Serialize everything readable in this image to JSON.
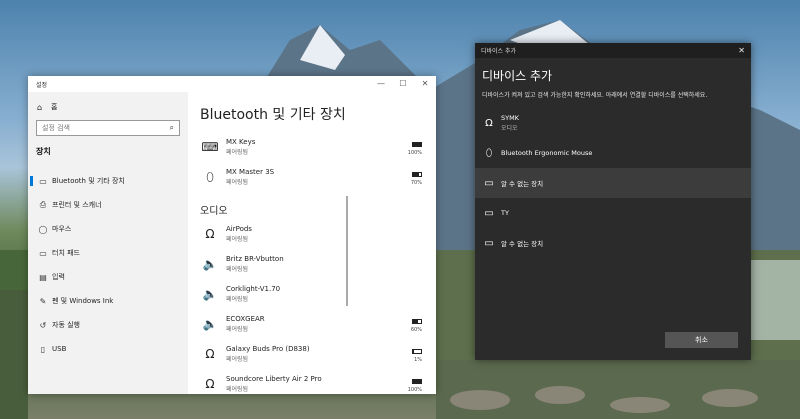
{
  "settings": {
    "window_title": "설정",
    "controls": {
      "minimize": "—",
      "maximize": "☐",
      "close": "✕"
    },
    "home_label": "홈",
    "search_placeholder": "설정 검색",
    "section_label": "장치",
    "nav": [
      {
        "label": "Bluetooth 및 기타 장치",
        "icon": "bluetooth-devices-icon",
        "glyph": "▭"
      },
      {
        "label": "프린터 및 스캐너",
        "icon": "printer-icon",
        "glyph": "⎙"
      },
      {
        "label": "마우스",
        "icon": "mouse-icon",
        "glyph": "◯"
      },
      {
        "label": "터치 패드",
        "icon": "touchpad-icon",
        "glyph": "▭"
      },
      {
        "label": "입력",
        "icon": "keyboard-icon",
        "glyph": "▤"
      },
      {
        "label": "펜 및 Windows Ink",
        "icon": "pen-icon",
        "glyph": "✎"
      },
      {
        "label": "자동 실행",
        "icon": "autoplay-icon",
        "glyph": "↺"
      },
      {
        "label": "USB",
        "icon": "usb-icon",
        "glyph": "▯"
      }
    ],
    "page_title": "Bluetooth 및 기타 장치",
    "devices_top": [
      {
        "name": "MX Keys",
        "status": "페어링됨",
        "battery": "100%",
        "level": 1.0,
        "icon": "keyboard-icon",
        "glyph": "⌨"
      },
      {
        "name": "MX Master 3S",
        "status": "페어링됨",
        "battery": "70%",
        "level": 0.7,
        "icon": "mouse-icon",
        "glyph": "⬯"
      }
    ],
    "audio_heading": "오디오",
    "devices_audio": [
      {
        "name": "AirPods",
        "status": "페어링됨",
        "battery": "",
        "level": null,
        "icon": "headphones-icon",
        "glyph": "Ω"
      },
      {
        "name": "Britz BR-Vbutton",
        "status": "페어링됨",
        "battery": "",
        "level": null,
        "icon": "speaker-icon",
        "glyph": "🔈"
      },
      {
        "name": "Corklight-V1.70",
        "status": "페어링됨",
        "battery": "",
        "level": null,
        "icon": "speaker-icon",
        "glyph": "🔈"
      },
      {
        "name": "ECOXGEAR",
        "status": "페어링됨",
        "battery": "60%",
        "level": 0.6,
        "icon": "speaker-icon",
        "glyph": "🔈"
      },
      {
        "name": "Galaxy Buds Pro (D838)",
        "status": "페어링됨",
        "battery": "1%",
        "level": 0.01,
        "icon": "headset-icon",
        "glyph": "Ω"
      },
      {
        "name": "Soundcore Liberty Air 2 Pro",
        "status": "페어링됨",
        "battery": "100%",
        "level": 1.0,
        "icon": "headset-icon",
        "glyph": "Ω"
      }
    ]
  },
  "dialog": {
    "title": "디바이스 추가",
    "close": "✕",
    "heading": "디바이스 추가",
    "description": "디바이스가 켜져 있고 검색 가능한지 확인하세요. 아래에서 연결할 디바이스를 선택하세요.",
    "devices": [
      {
        "name": "SYMK",
        "sub": "오디오",
        "icon": "headphones-icon",
        "glyph": "Ω",
        "highlighted": false
      },
      {
        "name": "Bluetooth Ergonomic Mouse",
        "sub": "",
        "icon": "mouse-icon",
        "glyph": "⬯",
        "highlighted": false
      },
      {
        "name": "알 수 없는 장치",
        "sub": "",
        "icon": "unknown-device-icon",
        "glyph": "▭",
        "highlighted": true
      },
      {
        "name": "TY",
        "sub": "",
        "icon": "unknown-device-icon",
        "glyph": "▭",
        "highlighted": false
      },
      {
        "name": "알 수 없는 장치",
        "sub": "",
        "icon": "unknown-device-icon",
        "glyph": "▭",
        "highlighted": false
      }
    ],
    "cancel_label": "취소"
  }
}
